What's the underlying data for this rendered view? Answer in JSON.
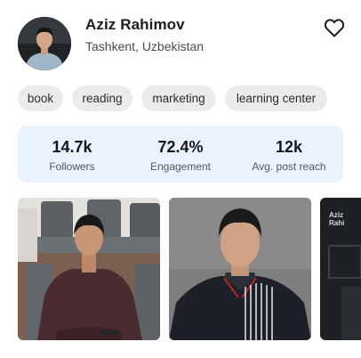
{
  "profile": {
    "name": "Aziz Rahimov",
    "location": "Tashkent, Uzbekistan",
    "favorite_icon": "heart-outline-icon"
  },
  "tags": [
    "book",
    "reading",
    "marketing",
    "learning center"
  ],
  "stats": [
    {
      "value": "14.7k",
      "label": "Followers"
    },
    {
      "value": "72.4%",
      "label": "Engagement"
    },
    {
      "value": "12k",
      "label": "Avg. post reach"
    }
  ],
  "gallery": {
    "photos": [
      {
        "description_icon": "photo-seated-chair"
      },
      {
        "description_icon": "photo-portrait-grey"
      },
      {
        "description_icon": "photo-dark-partial",
        "text": "Aziz\nRahi"
      }
    ]
  },
  "colors": {
    "tag_bg": "#ebebed",
    "stats_bg": "#e9f2fe",
    "text_primary": "#1c1c1e",
    "text_secondary": "#55585e"
  }
}
